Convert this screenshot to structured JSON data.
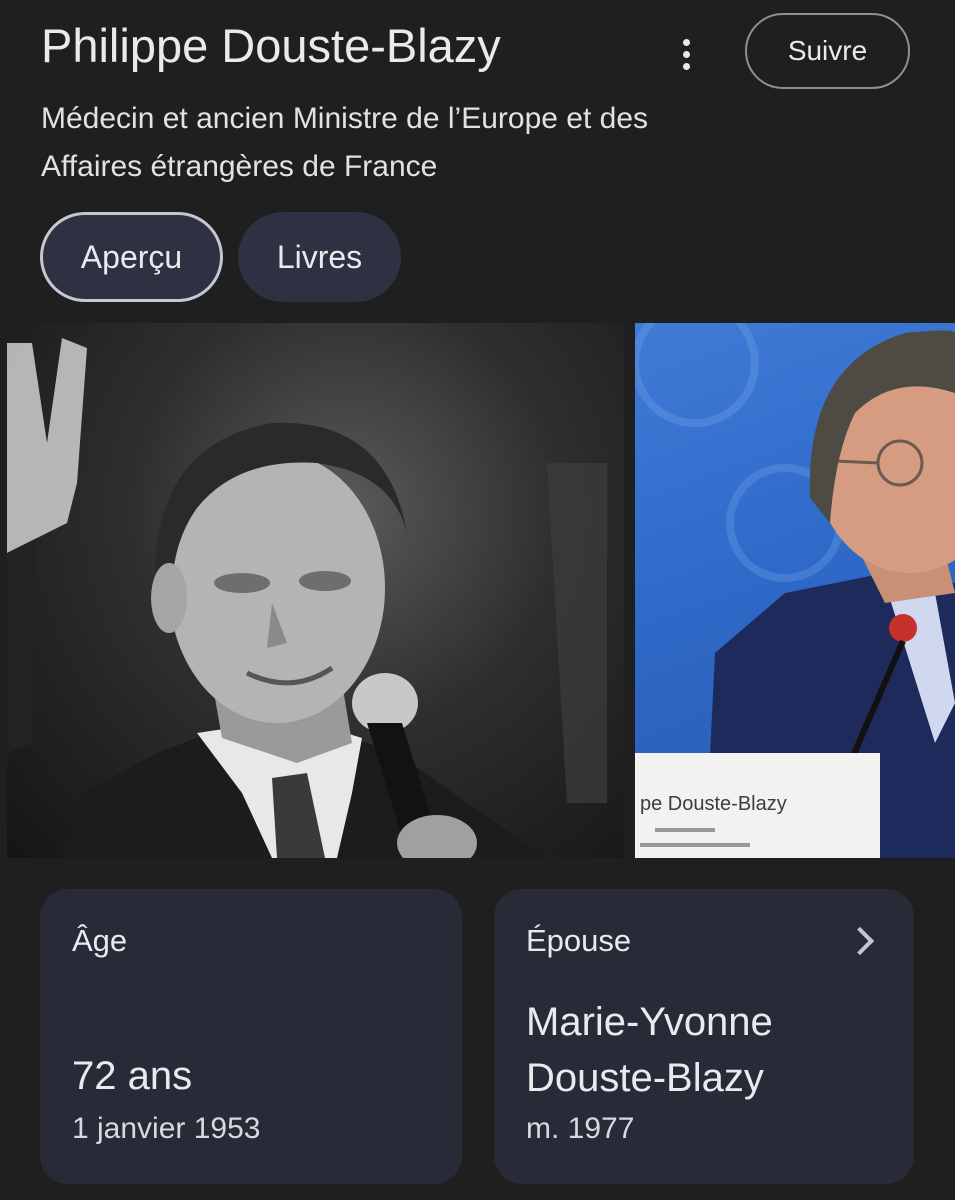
{
  "header": {
    "title": "Philippe Douste-Blazy",
    "follow_label": "Suivre",
    "more_icon": "more-vert-icon",
    "subtitle": "Médecin et ancien Ministre de l’Europe et des Affaires étrangères de France"
  },
  "tabs": [
    {
      "label": "Aperçu",
      "selected": true
    },
    {
      "label": "Livres",
      "selected": false
    }
  ],
  "images": [
    {
      "description": "black-and-white portrait holding microphone"
    },
    {
      "description": "color photo at press conference with name placard",
      "placard_text": "pe Douste-Blazy"
    }
  ],
  "cards": {
    "age": {
      "label": "Âge",
      "value": "72 ans",
      "sub": "1 janvier 1953"
    },
    "spouse": {
      "label": "Épouse",
      "value_line1": "Marie-Yvonne",
      "value_line2": "Douste-Blazy",
      "sub": "m. 1977",
      "icon": "chevron-right-icon"
    }
  },
  "colors": {
    "background": "#1f1f1f",
    "chip": "#2e3141",
    "card": "#282b37",
    "text": "#e8eaed"
  }
}
